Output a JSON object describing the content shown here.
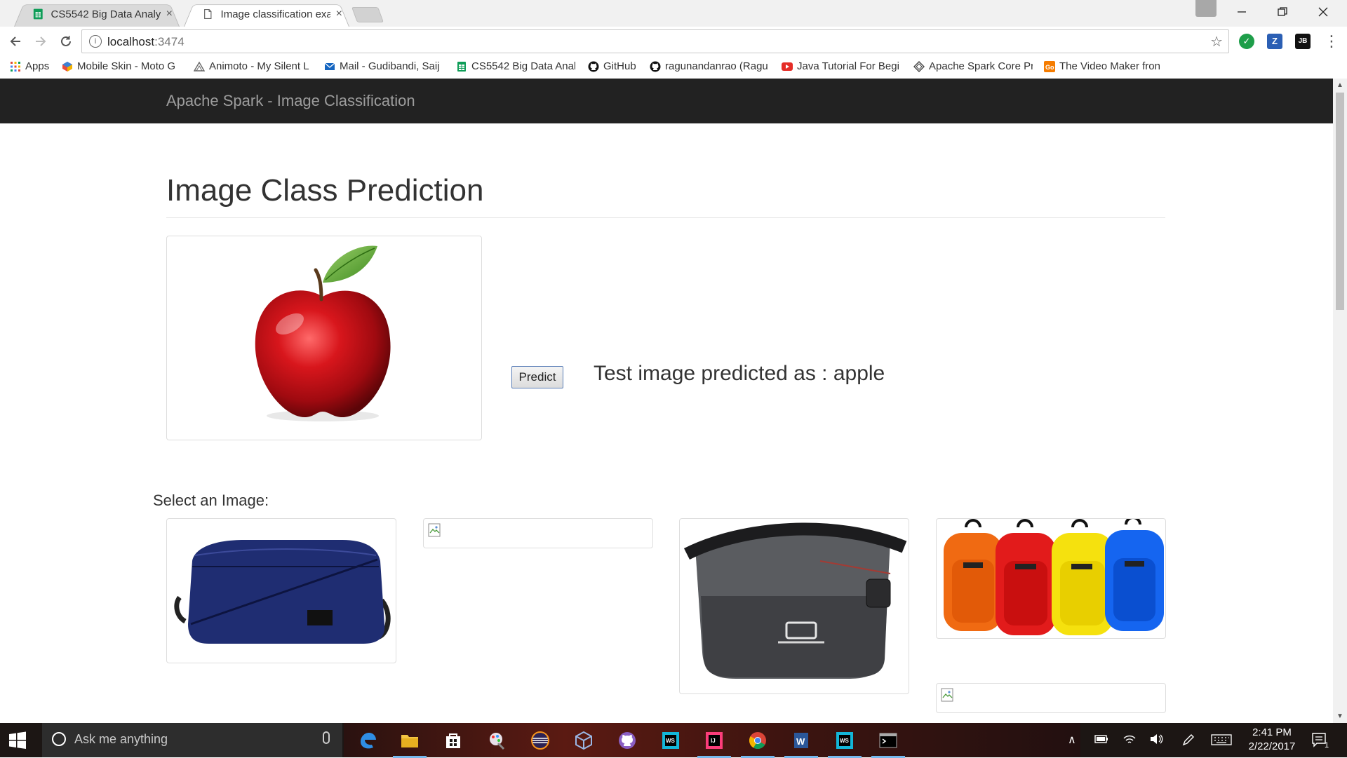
{
  "browser": {
    "tabs": [
      {
        "title": "CS5542 Big Data Analytic",
        "state": "inactive",
        "close": "×"
      },
      {
        "title": "Image classification exan",
        "state": "active",
        "close": "×"
      }
    ],
    "address": {
      "host": "localhost",
      "port": ":3474"
    },
    "extensions": [
      {
        "name": "check-icon",
        "label": "",
        "color": "#1e9e4a"
      },
      {
        "name": "z-extension-icon",
        "label": "Z",
        "color": "#2b5fb4"
      },
      {
        "name": "jb-extension-icon",
        "label": "JB",
        "color": "#111111"
      }
    ],
    "bookmarks": [
      {
        "label": "Apps",
        "icon": "apps-grid-icon"
      },
      {
        "label": "Mobile Skin - Moto G",
        "icon": "mobileskin-icon"
      },
      {
        "label": "Animoto - My Silent L",
        "icon": "animoto-icon"
      },
      {
        "label": "Mail - Gudibandi, Saij",
        "icon": "mail-icon"
      },
      {
        "label": "CS5542 Big Data Anal",
        "icon": "sheets-icon"
      },
      {
        "label": "GitHub",
        "icon": "github-icon"
      },
      {
        "label": "ragunandanrao (Ragu",
        "icon": "github-icon"
      },
      {
        "label": "Java Tutorial For Begi",
        "icon": "youtube-icon"
      },
      {
        "label": "Apache Spark Core Pr",
        "icon": "spark-icon"
      },
      {
        "label": "The Video Maker fron",
        "icon": "go-icon"
      }
    ]
  },
  "page": {
    "brand": "Apache Spark - Image Classification",
    "heading": "Image Class Prediction",
    "test_image": "apple",
    "predict_label": "Predict",
    "result_text": "Test image predicted as : apple",
    "select_label": "Select an Image:",
    "gallery": [
      {
        "name": "blue-messenger-bag",
        "kind": "bag-blue"
      },
      {
        "name": "broken-image",
        "kind": "broken"
      },
      {
        "name": "gray-messenger-bag",
        "kind": "bag-gray"
      },
      {
        "name": "colored-backpacks",
        "kind": "backpacks"
      },
      {
        "name": "broken-image",
        "kind": "broken"
      }
    ]
  },
  "taskbar": {
    "search_placeholder": "Ask me anything",
    "time": "2:41 PM",
    "date": "2/22/2017",
    "notification_count": "1",
    "apps": [
      "edge-icon",
      "file-explorer-icon",
      "store-icon",
      "paint-icon",
      "eclipse-icon",
      "virtualbox-icon",
      "github-desktop-icon",
      "webstorm-icon",
      "intellij-icon",
      "chrome-icon",
      "word-icon",
      "webstorm-icon",
      "terminal-icon"
    ]
  }
}
